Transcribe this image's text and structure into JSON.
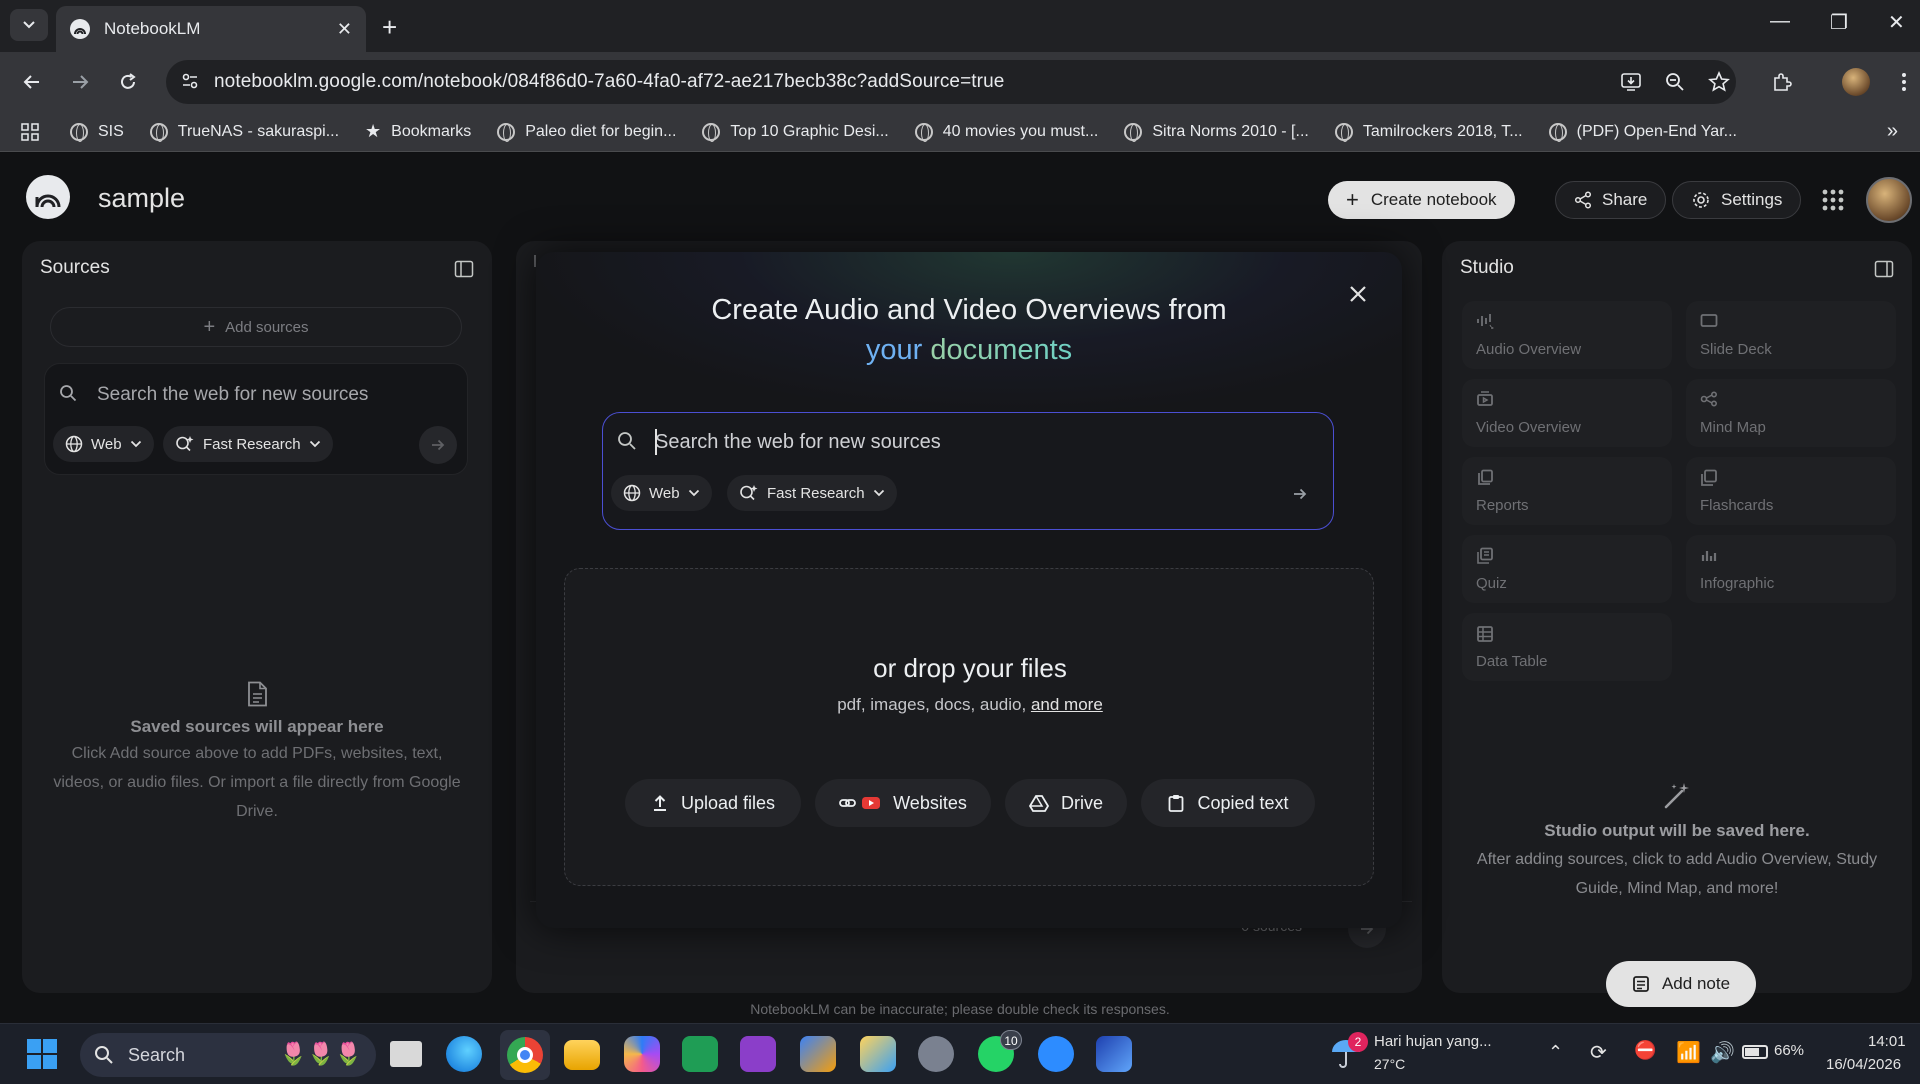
{
  "browser": {
    "tab_title": "NotebookLM",
    "url": "notebooklm.google.com/notebook/084f86d0-7a60-4fa0-af72-ae217becb38c?addSource=true",
    "bookmarks": [
      {
        "label": "SIS"
      },
      {
        "label": "TrueNAS - sakuraspi..."
      },
      {
        "label": "Bookmarks"
      },
      {
        "label": "Paleo diet for begin..."
      },
      {
        "label": "Top 10 Graphic Desi..."
      },
      {
        "label": "40 movies you must..."
      },
      {
        "label": "Sitra Norms 2010 - [..."
      },
      {
        "label": "Tamilrockers 2018, T..."
      },
      {
        "label": "(PDF) Open-End Yar..."
      }
    ]
  },
  "header": {
    "notebook_title": "sample",
    "create_label": "Create notebook",
    "share_label": "Share",
    "settings_label": "Settings"
  },
  "sources": {
    "title": "Sources",
    "add_label": "Add sources",
    "search_placeholder": "Search the web for new sources",
    "web_chip": "Web",
    "research_chip": "Fast Research",
    "empty_title": "Saved sources will appear here",
    "empty_text": "Click Add source above to add PDFs, websites, text, videos, or audio files. Or import a file directly from Google Drive."
  },
  "chat": {
    "sources_count": "0 sources"
  },
  "modal": {
    "title_line1": "Create Audio and Video Overviews from",
    "title_word1": "your",
    "title_word2": "documents",
    "search_placeholder": "Search the web for new sources",
    "web_chip": "Web",
    "research_chip": "Fast Research",
    "drop_title": "or drop your files",
    "drop_sub": "pdf, images, docs, audio,",
    "drop_more": "and more",
    "buttons": {
      "upload": "Upload files",
      "websites": "Websites",
      "drive": "Drive",
      "copied": "Copied text"
    }
  },
  "studio": {
    "title": "Studio",
    "tiles": [
      {
        "label": "Audio Overview",
        "icon": "audio-wave-icon"
      },
      {
        "label": "Slide Deck",
        "icon": "slides-icon"
      },
      {
        "label": "Video Overview",
        "icon": "video-icon"
      },
      {
        "label": "Mind Map",
        "icon": "mindmap-icon"
      },
      {
        "label": "Reports",
        "icon": "report-icon"
      },
      {
        "label": "Flashcards",
        "icon": "flashcards-icon"
      },
      {
        "label": "Quiz",
        "icon": "quiz-icon"
      },
      {
        "label": "Infographic",
        "icon": "infographic-icon"
      },
      {
        "label": "Data Table",
        "icon": "table-icon"
      }
    ],
    "empty_title": "Studio output will be saved here.",
    "empty_text": "After adding sources, click to add Audio Overview, Study Guide, Mind Map, and more!",
    "add_note_label": "Add note"
  },
  "footer_note": "NotebookLM can be inaccurate; please double check its responses.",
  "taskbar": {
    "search_label": "Search",
    "chrome_badge": "",
    "whatsapp_badge": "10",
    "weather_badge": "2",
    "weather_text": "Hari hujan yang...",
    "temperature": "27°C",
    "battery": "66%",
    "time": "14:01",
    "date": "16/04/2026"
  },
  "colors": {
    "accent_blue": "#4b4fd3",
    "title_blue": "#6fb1f2",
    "title_green": "#9ad1a7"
  }
}
